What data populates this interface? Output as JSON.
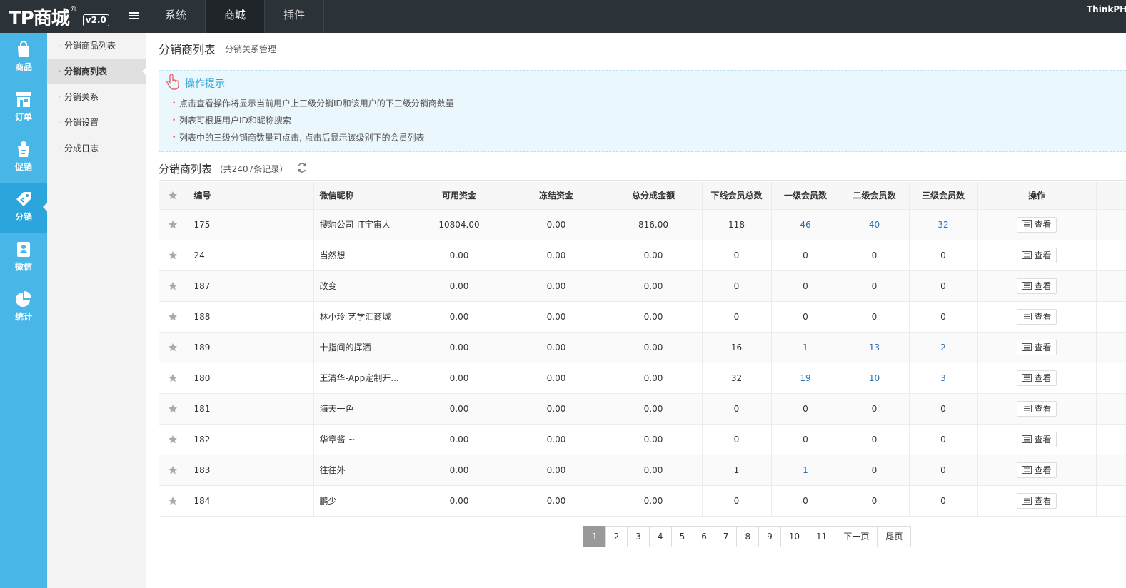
{
  "header": {
    "logo": "TP商城",
    "logo_reg": "®",
    "version": "v2.0",
    "nav": [
      {
        "label": "系统",
        "active": false
      },
      {
        "label": "商城",
        "active": true
      },
      {
        "label": "插件",
        "active": false
      }
    ],
    "right_text": "ThinkPH"
  },
  "iconbar": {
    "items": [
      {
        "label": "商品",
        "icon": "shopping-bag-icon",
        "active": false
      },
      {
        "label": "订单",
        "icon": "store-icon",
        "active": false
      },
      {
        "label": "促销",
        "icon": "promo-icon",
        "active": false
      },
      {
        "label": "分销",
        "icon": "distribution-tag-icon",
        "active": true
      },
      {
        "label": "微信",
        "icon": "wechat-icon",
        "active": false
      },
      {
        "label": "统计",
        "icon": "pie-chart-icon",
        "active": false
      }
    ]
  },
  "submenu": {
    "items": [
      {
        "label": "分销商品列表",
        "active": false
      },
      {
        "label": "分销商列表",
        "active": true
      },
      {
        "label": "分销关系",
        "active": false
      },
      {
        "label": "分销设置",
        "active": false
      },
      {
        "label": "分成日志",
        "active": false
      }
    ]
  },
  "page": {
    "title": "分销商列表",
    "subtitle": "分销关系管理"
  },
  "tips": {
    "title": "操作提示",
    "items": [
      "点击查看操作将显示当前用户上三级分销ID和该用户的下三级分销商数量",
      "列表可根据用户ID和昵称搜索",
      "列表中的三级分销商数量可点击, 点击后显示该级别下的会员列表"
    ]
  },
  "list": {
    "title": "分销商列表",
    "count_text": "(共2407条记录)"
  },
  "table": {
    "headers": [
      "编号",
      "微信昵称",
      "可用资金",
      "冻结资金",
      "总分成金额",
      "下线会员总数",
      "一级会员数",
      "二级会员数",
      "三级会员数",
      "操作"
    ],
    "view_label": "查看",
    "rows": [
      {
        "id": "175",
        "nickname": "搜豹公司-IT宇宙人",
        "available": "10804.00",
        "frozen": "0.00",
        "total": "816.00",
        "downline": "118",
        "l1": "46",
        "l2": "40",
        "l3": "32"
      },
      {
        "id": "24",
        "nickname": "当然想",
        "available": "0.00",
        "frozen": "0.00",
        "total": "0.00",
        "downline": "0",
        "l1": "0",
        "l2": "0",
        "l3": "0"
      },
      {
        "id": "187",
        "nickname": "改变",
        "available": "0.00",
        "frozen": "0.00",
        "total": "0.00",
        "downline": "0",
        "l1": "0",
        "l2": "0",
        "l3": "0"
      },
      {
        "id": "188",
        "nickname": "林小玲 艺学汇商城",
        "available": "0.00",
        "frozen": "0.00",
        "total": "0.00",
        "downline": "0",
        "l1": "0",
        "l2": "0",
        "l3": "0"
      },
      {
        "id": "189",
        "nickname": "十指间的挥洒",
        "available": "0.00",
        "frozen": "0.00",
        "total": "0.00",
        "downline": "16",
        "l1": "1",
        "l2": "13",
        "l3": "2"
      },
      {
        "id": "180",
        "nickname": "王清华-App定制开...",
        "available": "0.00",
        "frozen": "0.00",
        "total": "0.00",
        "downline": "32",
        "l1": "19",
        "l2": "10",
        "l3": "3"
      },
      {
        "id": "181",
        "nickname": "海天一色",
        "available": "0.00",
        "frozen": "0.00",
        "total": "0.00",
        "downline": "0",
        "l1": "0",
        "l2": "0",
        "l3": "0"
      },
      {
        "id": "182",
        "nickname": "华章酱 ~",
        "available": "0.00",
        "frozen": "0.00",
        "total": "0.00",
        "downline": "0",
        "l1": "0",
        "l2": "0",
        "l3": "0"
      },
      {
        "id": "183",
        "nickname": "往往外",
        "available": "0.00",
        "frozen": "0.00",
        "total": "0.00",
        "downline": "1",
        "l1": "1",
        "l2": "0",
        "l3": "0"
      },
      {
        "id": "184",
        "nickname": "鹏少",
        "available": "0.00",
        "frozen": "0.00",
        "total": "0.00",
        "downline": "0",
        "l1": "0",
        "l2": "0",
        "l3": "0"
      }
    ]
  },
  "pagination": {
    "pages": [
      "1",
      "2",
      "3",
      "4",
      "5",
      "6",
      "7",
      "8",
      "9",
      "10",
      "11"
    ],
    "current": "1",
    "next": "下一页",
    "last": "尾页"
  },
  "colors": {
    "topbar": "#2b3238",
    "iconbar": "#48b7e8",
    "link": "#2a6fb5",
    "tips_bg": "#eaf7fd"
  }
}
